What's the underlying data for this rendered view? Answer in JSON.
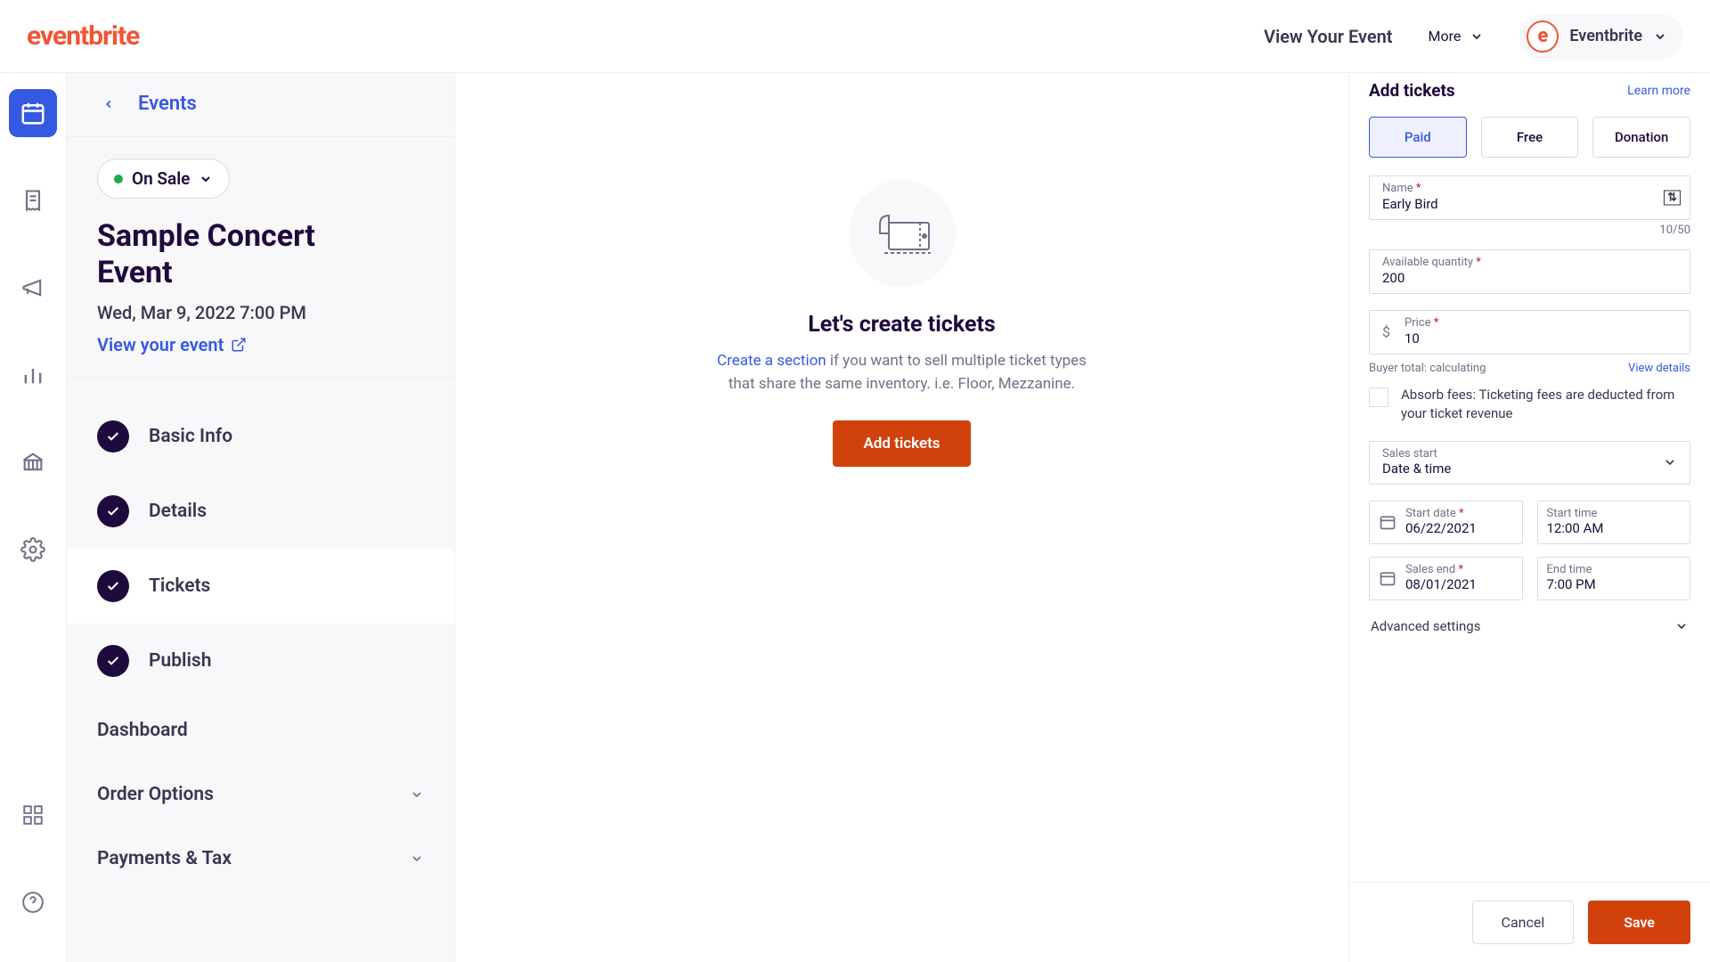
{
  "header": {
    "logo": "eventbrite",
    "view_event": "View Your Event",
    "more": "More",
    "user_name": "Eventbrite",
    "avatar_letter": "e"
  },
  "sidebar": {
    "back_label": "Events",
    "status": "On Sale",
    "event_title": "Sample Concert Event",
    "event_date": "Wed, Mar 9, 2022 7:00 PM",
    "view_link": "View your event",
    "steps": [
      {
        "label": "Basic Info"
      },
      {
        "label": "Details"
      },
      {
        "label": "Tickets"
      },
      {
        "label": "Publish"
      }
    ],
    "dashboard": "Dashboard",
    "order_options": "Order Options",
    "payments_tax": "Payments & Tax"
  },
  "main": {
    "heading": "Let's create tickets",
    "create_section": "Create a section",
    "sub_text_1": " if you want to sell multiple ticket types that share the same inventory. i.e. Floor, Mezzanine.",
    "add_tickets_btn": "Add tickets"
  },
  "panel": {
    "title": "Add tickets",
    "learn_more": "Learn more",
    "tabs": {
      "paid": "Paid",
      "free": "Free",
      "donation": "Donation"
    },
    "name_label": "Name",
    "name_value": "Early Bird",
    "name_count": "10/50",
    "qty_label": "Available quantity",
    "qty_value": "200",
    "price_label": "Price",
    "price_value": "10",
    "currency": "$",
    "buyer_total": "Buyer total: calculating",
    "view_details": "View details",
    "absorb_fees": "Absorb fees: Ticketing fees are deducted from your ticket revenue",
    "sales_start_label": "Sales start",
    "sales_start_value": "Date & time",
    "start_date_label": "Start date",
    "start_date_value": "06/22/2021",
    "start_time_label": "Start time",
    "start_time_value": "12:00 AM",
    "end_date_label": "Sales end",
    "end_date_value": "08/01/2021",
    "end_time_label": "End time",
    "end_time_value": "7:00 PM",
    "advanced": "Advanced settings",
    "cancel": "Cancel",
    "save": "Save"
  }
}
